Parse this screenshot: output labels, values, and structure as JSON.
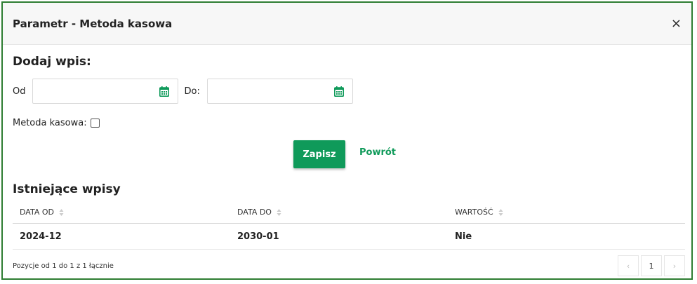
{
  "modal": {
    "title": "Parametr - Metoda kasowa",
    "close_label": "×"
  },
  "form": {
    "section_title": "Dodaj wpis:",
    "from_label": "Od",
    "from_value": "",
    "to_label": "Do:",
    "to_value": "",
    "checkbox_label": "Metoda kasowa:",
    "checkbox_checked": false,
    "save_label": "Zapisz",
    "back_label": "Powrót"
  },
  "existing": {
    "section_title": "Istniejące wpisy",
    "columns": [
      "DATA OD",
      "DATA DO",
      "WARTOŚĆ"
    ],
    "rows": [
      [
        "2024-12",
        "2030-01",
        "Nie"
      ]
    ]
  },
  "pagination": {
    "summary": "Pozycje od 1 do 1 z 1 łącznie",
    "prev": "‹",
    "current_page": "1",
    "next": "›"
  },
  "colors": {
    "accent": "#0f9a5a",
    "border": "#2e7d32"
  }
}
